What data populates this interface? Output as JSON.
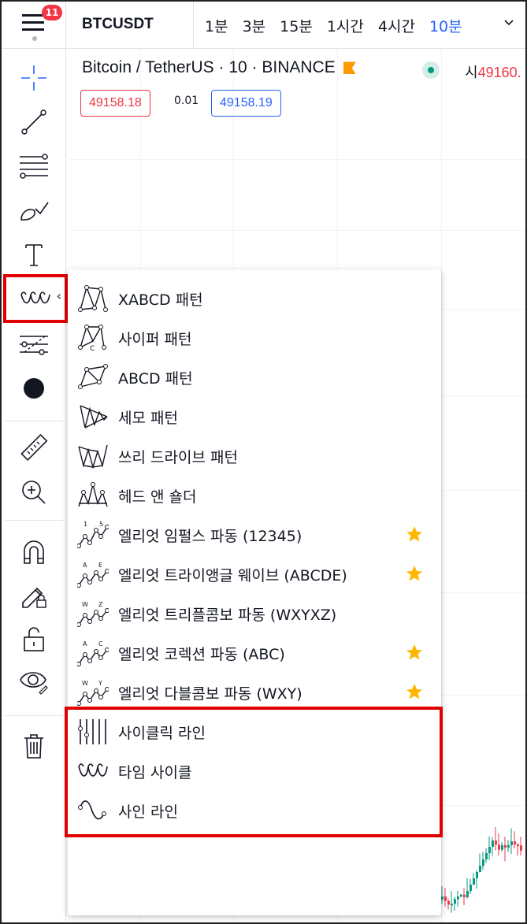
{
  "topbar": {
    "menu_badge": "11",
    "symbol": "BTCUSDT",
    "intervals": [
      "1분",
      "3분",
      "15분",
      "1시간",
      "4시간",
      "10분"
    ],
    "active_interval": "10분"
  },
  "legend": {
    "title": "Bitcoin / TetherUS · 10 · BINANCE",
    "open_label": "시",
    "open_value": "49160.",
    "sell_price": "49158.18",
    "spread": "0.01",
    "buy_price": "49158.19"
  },
  "toolbar": {
    "tools": [
      "crosshair-icon",
      "trend-line-icon",
      "fib-retracement-icon",
      "brush-icon",
      "text-icon",
      "patterns-icon",
      "prediction-icon",
      "color-dot-icon",
      "ruler-icon",
      "zoom-in-icon",
      "magnet-icon",
      "lock-drawing-icon",
      "unlock-icon",
      "eye-icon",
      "trash-icon"
    ]
  },
  "dropdown": {
    "items": [
      {
        "label": "XABCD 패턴",
        "icon": "xabcd-pattern-icon",
        "starred": false
      },
      {
        "label": "사이퍼 패턴",
        "icon": "cypher-pattern-icon",
        "starred": false
      },
      {
        "label": "ABCD 패턴",
        "icon": "abcd-pattern-icon",
        "starred": false
      },
      {
        "label": "세모 패턴",
        "icon": "triangle-pattern-icon",
        "starred": false
      },
      {
        "label": "쓰리 드라이브 패턴",
        "icon": "three-drives-pattern-icon",
        "starred": false
      },
      {
        "label": "헤드 앤 숄더",
        "icon": "head-shoulders-icon",
        "starred": false
      },
      {
        "label": "엘리엇 임펄스 파동 (12345)",
        "icon": "elliott-impulse-icon",
        "starred": true
      },
      {
        "label": "엘리엇 트라이앵글 웨이브 (ABCDE)",
        "icon": "elliott-triangle-icon",
        "starred": true
      },
      {
        "label": "엘리엇 트리플콤보 파동 (WXYXZ)",
        "icon": "elliott-triple-combo-icon",
        "starred": false
      },
      {
        "label": "엘리엇 코렉션 파동 (ABC)",
        "icon": "elliott-correction-icon",
        "starred": true
      },
      {
        "label": "엘리엇 다블콤보 파동 (WXY)",
        "icon": "elliott-double-combo-icon",
        "starred": true
      },
      {
        "label": "사이클릭 라인",
        "icon": "cyclic-lines-icon",
        "starred": false
      },
      {
        "label": "타임 사이클",
        "icon": "time-cycles-icon",
        "starred": false
      },
      {
        "label": "사인 라인",
        "icon": "sine-line-icon",
        "starred": false
      }
    ]
  },
  "colors": {
    "accent": "#2962ff",
    "down": "#f23645",
    "up": "#089981",
    "highlight": "#e00000",
    "star": "#ffb600"
  }
}
